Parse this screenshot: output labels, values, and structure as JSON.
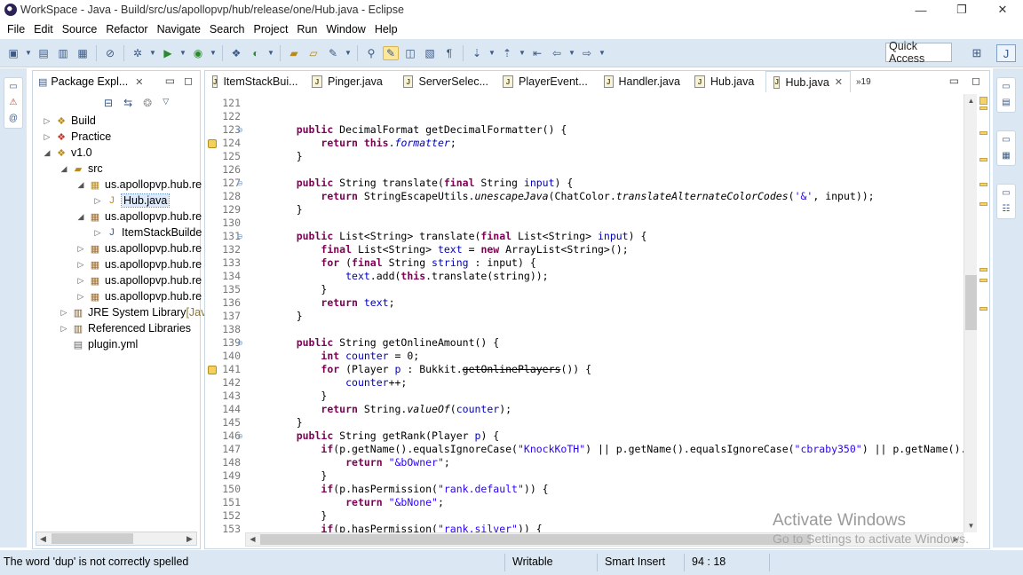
{
  "window": {
    "title": "WorkSpace - Java - Build/src/us/apollopvp/hub/release/one/Hub.java - Eclipse",
    "controls": [
      "—",
      "❐",
      "✕"
    ]
  },
  "menu": [
    "File",
    "Edit",
    "Source",
    "Refactor",
    "Navigate",
    "Search",
    "Project",
    "Run",
    "Window",
    "Help"
  ],
  "toolbar": {
    "quick_access": "Quick Access"
  },
  "explorer": {
    "tab_label": "Package Expl...",
    "tree": [
      {
        "label": "Build",
        "depth": 0,
        "twisty": "▷",
        "icon": "project-icon"
      },
      {
        "label": "Practice",
        "depth": 0,
        "twisty": "▷",
        "icon": "project-error-icon"
      },
      {
        "label": "v1.0",
        "depth": 0,
        "twisty": "◢",
        "icon": "project-icon"
      },
      {
        "label": "src",
        "depth": 1,
        "twisty": "◢",
        "icon": "source-folder-icon"
      },
      {
        "label": "us.apollopvp.hub.re",
        "depth": 2,
        "twisty": "◢",
        "icon": "package-warning-icon"
      },
      {
        "label": "Hub.java",
        "depth": 3,
        "twisty": "▷",
        "icon": "java-file-warning-icon",
        "selected": true
      },
      {
        "label": "us.apollopvp.hub.re",
        "depth": 2,
        "twisty": "◢",
        "icon": "package-icon"
      },
      {
        "label": "ItemStackBuilde",
        "depth": 3,
        "twisty": "▷",
        "icon": "java-file-icon"
      },
      {
        "label": "us.apollopvp.hub.re",
        "depth": 2,
        "twisty": "▷",
        "icon": "package-icon"
      },
      {
        "label": "us.apollopvp.hub.re",
        "depth": 2,
        "twisty": "▷",
        "icon": "package-icon"
      },
      {
        "label": "us.apollopvp.hub.re",
        "depth": 2,
        "twisty": "▷",
        "icon": "package-icon"
      },
      {
        "label": "us.apollopvp.hub.re",
        "depth": 2,
        "twisty": "▷",
        "icon": "package-icon"
      },
      {
        "label": "JRE System Library",
        "suffix": " [Jav",
        "depth": 1,
        "twisty": "▷",
        "icon": "library-icon"
      },
      {
        "label": "Referenced Libraries",
        "depth": 1,
        "twisty": "▷",
        "icon": "library-icon"
      },
      {
        "label": "plugin.yml",
        "depth": 1,
        "twisty": "",
        "icon": "file-icon"
      }
    ]
  },
  "editor": {
    "tabs": [
      {
        "label": "ItemStackBui...",
        "active": false
      },
      {
        "label": "Pinger.java",
        "active": false
      },
      {
        "label": "ServerSelec...",
        "active": false
      },
      {
        "label": "PlayerEvent...",
        "active": false
      },
      {
        "label": "Handler.java",
        "active": false
      },
      {
        "label": "Hub.java",
        "active": false
      },
      {
        "label": "Hub.java",
        "active": true
      }
    ],
    "overflow_count": "»19",
    "lines": [
      {
        "n": "121",
        "fold": false,
        "warn": false,
        "html": ""
      },
      {
        "n": "122",
        "fold": false,
        "warn": false,
        "html": ""
      },
      {
        "n": "123",
        "fold": true,
        "warn": false,
        "html": "    <span class='kw'>public</span> DecimalFormat getDecimalFormatter() {"
      },
      {
        "n": "124",
        "fold": false,
        "warn": true,
        "html": "        <span class='kw'>return</span> <span class='kw'>this</span>.<span class='ital-field'>formatter</span>;"
      },
      {
        "n": "125",
        "fold": false,
        "warn": false,
        "html": "    }"
      },
      {
        "n": "126",
        "fold": false,
        "warn": false,
        "html": ""
      },
      {
        "n": "127",
        "fold": true,
        "warn": false,
        "html": "    <span class='kw'>public</span> String translate(<span class='kw'>final</span> String <span class='fld'>input</span>) {"
      },
      {
        "n": "128",
        "fold": false,
        "warn": false,
        "html": "        <span class='kw'>return</span> StringEscapeUtils.<span class='it'>unescapeJava</span>(ChatColor.<span class='it'>translateAlternateColorCodes</span>(<span class='str'>'&amp;'</span>, input));"
      },
      {
        "n": "129",
        "fold": false,
        "warn": false,
        "html": "    }"
      },
      {
        "n": "130",
        "fold": false,
        "warn": false,
        "html": ""
      },
      {
        "n": "131",
        "fold": true,
        "warn": false,
        "html": "    <span class='kw'>public</span> List&lt;String&gt; translate(<span class='kw'>final</span> List&lt;String&gt; <span class='fld'>input</span>) {"
      },
      {
        "n": "132",
        "fold": false,
        "warn": false,
        "html": "        <span class='kw'>final</span> List&lt;String&gt; <span class='fld'>text</span> = <span class='kw'>new</span> ArrayList&lt;String&gt;();"
      },
      {
        "n": "133",
        "fold": false,
        "warn": false,
        "html": "        <span class='kw'>for</span> (<span class='kw'>final</span> String <span class='fld'>string</span> : input) {"
      },
      {
        "n": "134",
        "fold": false,
        "warn": false,
        "html": "            <span class='fld'>text</span>.add(<span class='kw'>this</span>.translate(string));"
      },
      {
        "n": "135",
        "fold": false,
        "warn": false,
        "html": "        }"
      },
      {
        "n": "136",
        "fold": false,
        "warn": false,
        "html": "        <span class='kw'>return</span> <span class='fld'>text</span>;"
      },
      {
        "n": "137",
        "fold": false,
        "warn": false,
        "html": "    }"
      },
      {
        "n": "138",
        "fold": false,
        "warn": false,
        "html": ""
      },
      {
        "n": "139",
        "fold": true,
        "warn": false,
        "html": "    <span class='kw'>public</span> String getOnlineAmount() {"
      },
      {
        "n": "140",
        "fold": false,
        "warn": false,
        "html": "        <span class='kw'>int</span> <span class='fld'>counter</span> = 0;"
      },
      {
        "n": "141",
        "fold": false,
        "warn": true,
        "html": "        <span class='kw'>for</span> (Player <span class='fld'>p</span> : Bukkit.<span class='dep'>getOnlinePlayers</span>()) {"
      },
      {
        "n": "142",
        "fold": false,
        "warn": false,
        "html": "            <span class='fld'>counter</span>++;"
      },
      {
        "n": "143",
        "fold": false,
        "warn": false,
        "html": "        }"
      },
      {
        "n": "144",
        "fold": false,
        "warn": false,
        "html": "        <span class='kw'>return</span> String.<span class='it'>valueOf</span>(<span class='fld'>counter</span>);"
      },
      {
        "n": "145",
        "fold": false,
        "warn": false,
        "html": "    }"
      },
      {
        "n": "146",
        "fold": true,
        "warn": false,
        "html": "    <span class='kw'>public</span> String getRank(Player <span class='fld'>p</span>) {"
      },
      {
        "n": "147",
        "fold": false,
        "warn": false,
        "html": "        <span class='kw'>if</span>(p.getName().equalsIgnoreCase(<span class='str'>\"KnockKoTH\"</span>) || p.getName().equalsIgnoreCase(<span class='str'>\"cbraby350\"</span>) || p.getName().eq"
      },
      {
        "n": "148",
        "fold": false,
        "warn": false,
        "html": "            <span class='kw'>return</span> <span class='str'>\"&amp;bOwner\"</span>;"
      },
      {
        "n": "149",
        "fold": false,
        "warn": false,
        "html": "        }"
      },
      {
        "n": "150",
        "fold": false,
        "warn": false,
        "html": "        <span class='kw'>if</span>(p.hasPermission(<span class='str'>\"rank.default\"</span>)) {"
      },
      {
        "n": "151",
        "fold": false,
        "warn": false,
        "html": "            <span class='kw'>return</span> <span class='str'>\"&amp;bNone\"</span>;"
      },
      {
        "n": "152",
        "fold": false,
        "warn": false,
        "html": "        }"
      },
      {
        "n": "153",
        "fold": false,
        "warn": false,
        "html": "        <span class='kw'>if</span>(p.hasPermission(<span class='str'>\"rank.silver\"</span>)) {"
      }
    ]
  },
  "status": {
    "message": "The word 'dup' is not correctly spelled",
    "mode": "Writable",
    "insert": "Smart Insert",
    "position": "94 : 18"
  },
  "watermark": {
    "title": "Activate Windows",
    "subtitle": "Go to Settings to activate Windows."
  }
}
